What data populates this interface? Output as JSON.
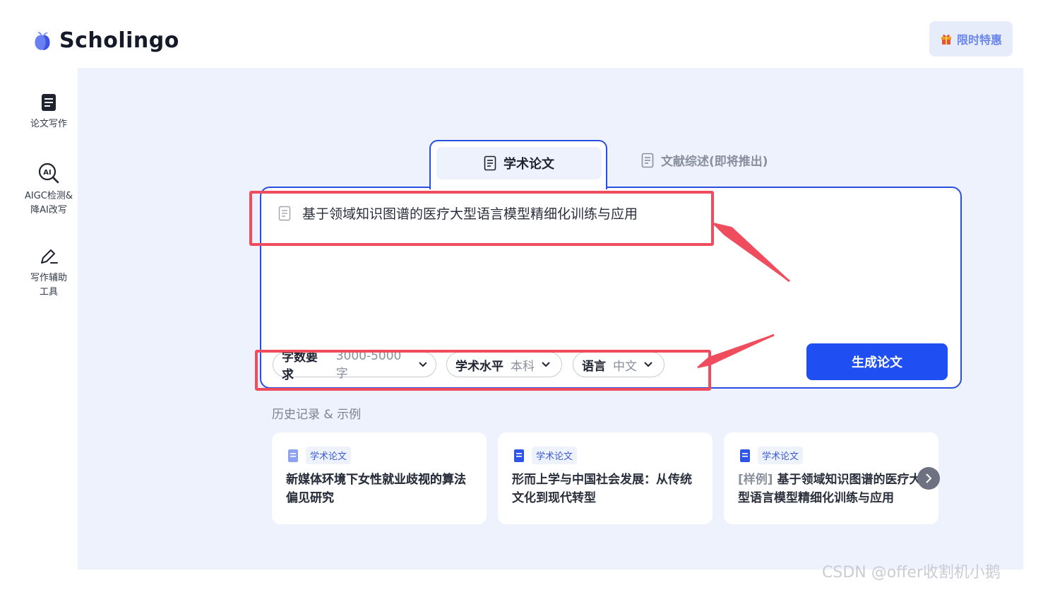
{
  "app": {
    "name": "Scholingo",
    "promo_label": "限时特惠"
  },
  "sidebar": {
    "items": [
      {
        "label": "论文写作"
      },
      {
        "label": "AIGC检测&",
        "label2": "降AI改写"
      },
      {
        "label": "写作辅助",
        "label2": "工具"
      }
    ]
  },
  "tabs": {
    "active": "学术论文",
    "inactive": "文献综述(即将推出)"
  },
  "editor": {
    "title": "基于领域知识图谱的医疗大型语言模型精细化训练与应用"
  },
  "options": [
    {
      "key": "字数要求",
      "value": "3000-5000字"
    },
    {
      "key": "学术水平",
      "value": "本科"
    },
    {
      "key": "语言",
      "value": "中文"
    }
  ],
  "generate_label": "生成论文",
  "history": {
    "title": "历史记录 & 示例",
    "cards": [
      {
        "badge": "学术论文",
        "title": "新媒体环境下女性就业歧视的算法偏见研究"
      },
      {
        "badge": "学术论文",
        "title": "形而上学与中国社会发展：从传统文化到现代转型"
      },
      {
        "badge": "学术论文",
        "tag": "[样例]",
        "title": " 基于领域知识图谱的医疗大型语言模型精细化训练与应用"
      }
    ]
  },
  "watermark": "CSDN @offer收割机小鹅",
  "colors": {
    "accent": "#1f4ef2",
    "highlight": "#ef4d5e",
    "background": "#eef2fd"
  }
}
